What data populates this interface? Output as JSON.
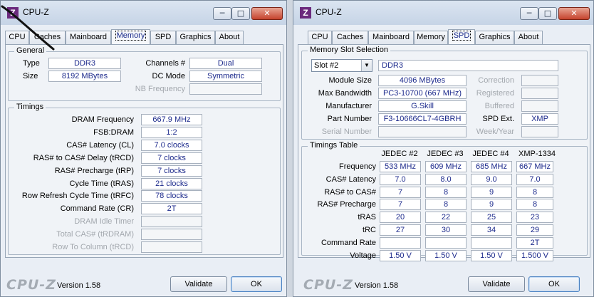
{
  "left": {
    "window_title": "CPU-Z",
    "app_icon": "Z",
    "tabs": [
      "CPU",
      "Caches",
      "Mainboard",
      "Memory",
      "SPD",
      "Graphics",
      "About"
    ],
    "active_tab": "Memory",
    "general": {
      "title": "General",
      "type_label": "Type",
      "type": "DDR3",
      "size_label": "Size",
      "size": "8192 MBytes",
      "channels_label": "Channels #",
      "channels": "Dual",
      "dcmode_label": "DC Mode",
      "dcmode": "Symmetric",
      "nbfreq_label": "NB Frequency",
      "nbfreq": ""
    },
    "timings": {
      "title": "Timings",
      "rows": [
        {
          "label": "DRAM Frequency",
          "value": "667.9 MHz",
          "disabled": false
        },
        {
          "label": "FSB:DRAM",
          "value": "1:2",
          "disabled": false
        },
        {
          "label": "CAS# Latency (CL)",
          "value": "7.0 clocks",
          "disabled": false
        },
        {
          "label": "RAS# to CAS# Delay (tRCD)",
          "value": "7 clocks",
          "disabled": false
        },
        {
          "label": "RAS# Precharge (tRP)",
          "value": "7 clocks",
          "disabled": false
        },
        {
          "label": "Cycle Time (tRAS)",
          "value": "21 clocks",
          "disabled": false
        },
        {
          "label": "Row Refresh Cycle Time (tRFC)",
          "value": "78 clocks",
          "disabled": false
        },
        {
          "label": "Command Rate (CR)",
          "value": "2T",
          "disabled": false
        },
        {
          "label": "DRAM Idle Timer",
          "value": "",
          "disabled": true
        },
        {
          "label": "Total CAS# (tRDRAM)",
          "value": "",
          "disabled": true
        },
        {
          "label": "Row To Column (tRCD)",
          "value": "",
          "disabled": true
        }
      ]
    },
    "footer": {
      "logo": "CPU-Z",
      "version": "Version 1.58",
      "validate": "Validate",
      "ok": "OK"
    }
  },
  "right": {
    "window_title": "CPU-Z",
    "app_icon": "Z",
    "tabs": [
      "CPU",
      "Caches",
      "Mainboard",
      "Memory",
      "SPD",
      "Graphics",
      "About"
    ],
    "active_tab": "SPD",
    "slot": {
      "title": "Memory Slot Selection",
      "selected": "Slot #2",
      "type": "DDR3",
      "module_size_label": "Module Size",
      "module_size": "4096 MBytes",
      "max_bw_label": "Max Bandwidth",
      "max_bw": "PC3-10700 (667 MHz)",
      "manufacturer_label": "Manufacturer",
      "manufacturer": "G.Skill",
      "part_label": "Part Number",
      "part": "F3-10666CL7-4GBRH",
      "serial_label": "Serial Number",
      "serial": "",
      "correction_label": "Correction",
      "correction": "",
      "registered_label": "Registered",
      "registered": "",
      "buffered_label": "Buffered",
      "buffered": "",
      "spdext_label": "SPD Ext.",
      "spdext": "XMP",
      "weekyear_label": "Week/Year",
      "weekyear": ""
    },
    "table": {
      "title": "Timings Table",
      "columns": [
        "JEDEC #2",
        "JEDEC #3",
        "JEDEC #4",
        "XMP-1334"
      ],
      "rows": [
        {
          "label": "Frequency",
          "values": [
            "533 MHz",
            "609 MHz",
            "685 MHz",
            "667 MHz"
          ]
        },
        {
          "label": "CAS# Latency",
          "values": [
            "7.0",
            "8.0",
            "9.0",
            "7.0"
          ]
        },
        {
          "label": "RAS# to CAS#",
          "values": [
            "7",
            "8",
            "9",
            "8"
          ]
        },
        {
          "label": "RAS# Precharge",
          "values": [
            "7",
            "8",
            "9",
            "8"
          ]
        },
        {
          "label": "tRAS",
          "values": [
            "20",
            "22",
            "25",
            "23"
          ]
        },
        {
          "label": "tRC",
          "values": [
            "27",
            "30",
            "34",
            "29"
          ]
        },
        {
          "label": "Command Rate",
          "values": [
            "",
            "",
            "",
            "2T"
          ]
        },
        {
          "label": "Voltage",
          "values": [
            "1.50 V",
            "1.50 V",
            "1.50 V",
            "1.500 V"
          ]
        }
      ]
    },
    "footer": {
      "logo": "CPU-Z",
      "version": "Version 1.58",
      "validate": "Validate",
      "ok": "OK"
    }
  }
}
